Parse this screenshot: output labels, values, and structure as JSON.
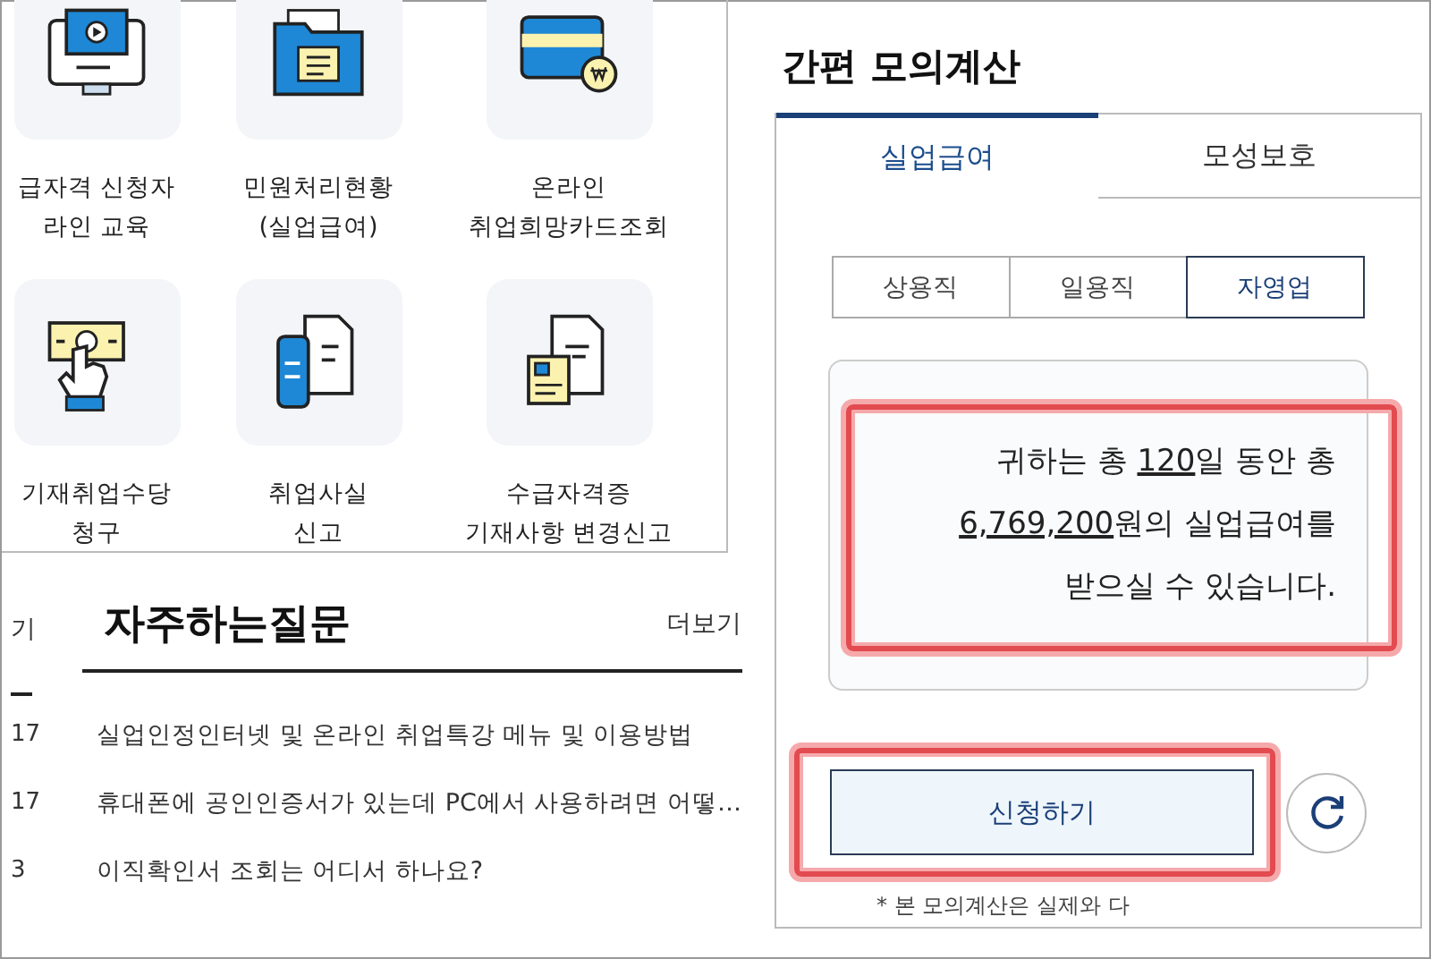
{
  "services": [
    {
      "kind": "monitor",
      "lines": [
        "급자격 신청자",
        "라인 교육"
      ]
    },
    {
      "kind": "folder",
      "lines": [
        "민원처리현황",
        "(실업급여)"
      ]
    },
    {
      "kind": "card",
      "lines": [
        "온라인",
        "취업희망카드조회"
      ]
    },
    {
      "kind": "bill",
      "lines": [
        "기재취업수당",
        "청구"
      ]
    },
    {
      "kind": "phone",
      "lines": [
        "취업사실",
        "신고"
      ]
    },
    {
      "kind": "certificate",
      "lines": [
        "수급자격증",
        "기재사항 변경신고"
      ]
    }
  ],
  "faq": {
    "side_label": "기",
    "title": "자주하는질문",
    "more": "더보기",
    "items": [
      {
        "date": "17",
        "title": "실업인정인터넷 및 온라인 취업특강 메뉴 및 이용방법"
      },
      {
        "date": "17",
        "title": "휴대폰에 공인인증서가 있는데 PC에서 사용하려면 어떻…"
      },
      {
        "date": "3",
        "title": "이직확인서 조회는 어디서 하나요?"
      }
    ]
  },
  "calculator": {
    "title": "간편 모의계산",
    "tabs": [
      {
        "label": "실업급여",
        "selected": true
      },
      {
        "label": "모성보호",
        "selected": false
      }
    ],
    "segments": [
      {
        "label": "상용직",
        "selected": false
      },
      {
        "label": "일용직",
        "selected": false
      },
      {
        "label": "자영업",
        "selected": true
      }
    ],
    "result": {
      "highlighted": true,
      "lines": [
        [
          {
            "text": "귀하는 총 ",
            "underline": false
          },
          {
            "text": "120",
            "underline": true
          },
          {
            "text": "일 동안 총",
            "underline": false
          }
        ],
        [
          {
            "text": "6,769,200",
            "underline": true
          },
          {
            "text": "원의 실업급여를",
            "underline": false
          }
        ],
        [
          {
            "text": "받으실 수 있습니다.",
            "underline": false
          }
        ]
      ]
    },
    "apply_button": {
      "label": "신청하기",
      "highlighted": true
    },
    "footnote": "* 본 모의계산은 실제와 다"
  }
}
